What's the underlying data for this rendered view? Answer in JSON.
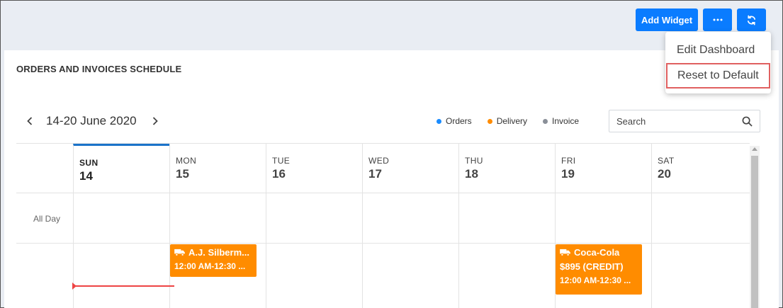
{
  "toolbar": {
    "add_widget_label": "Add Widget",
    "more_icon": "more-horizontal-icon",
    "refresh_icon": "refresh-icon"
  },
  "dropdown": {
    "items": [
      {
        "label": "Edit Dashboard"
      },
      {
        "label": "Reset to Default"
      }
    ]
  },
  "widget": {
    "title": "ORDERS AND INVOICES SCHEDULE",
    "date_range": "14-20 June 2020",
    "legend": [
      {
        "label": "Orders",
        "color": "#1a8cff"
      },
      {
        "label": "Delivery",
        "color": "#ff8c00"
      },
      {
        "label": "Invoice",
        "color": "#8a8f98"
      }
    ],
    "search_placeholder": "Search"
  },
  "calendar": {
    "days": [
      {
        "name": "SUN",
        "date": "14",
        "today": true
      },
      {
        "name": "MON",
        "date": "15"
      },
      {
        "name": "TUE",
        "date": "16"
      },
      {
        "name": "WED",
        "date": "17"
      },
      {
        "name": "THU",
        "date": "18"
      },
      {
        "name": "FRI",
        "date": "19"
      },
      {
        "name": "SAT",
        "date": "20"
      }
    ],
    "all_day_label": "All Day",
    "events": [
      {
        "day": "MON",
        "title": "A.J. Silberm...",
        "time": "12:00 AM-12:30 ...",
        "type": "Delivery",
        "icon": "truck-icon"
      },
      {
        "day": "FRI",
        "title": "Coca-Cola",
        "amount": "$895 (CREDIT)",
        "time": "12:00 AM-12:30 ...",
        "type": "Delivery",
        "icon": "truck-icon"
      }
    ]
  },
  "colors": {
    "accent_blue": "#0a7cff",
    "delivery_orange": "#ff8c00",
    "today_marker": "#1a73c9",
    "now_line": "#e44444"
  }
}
